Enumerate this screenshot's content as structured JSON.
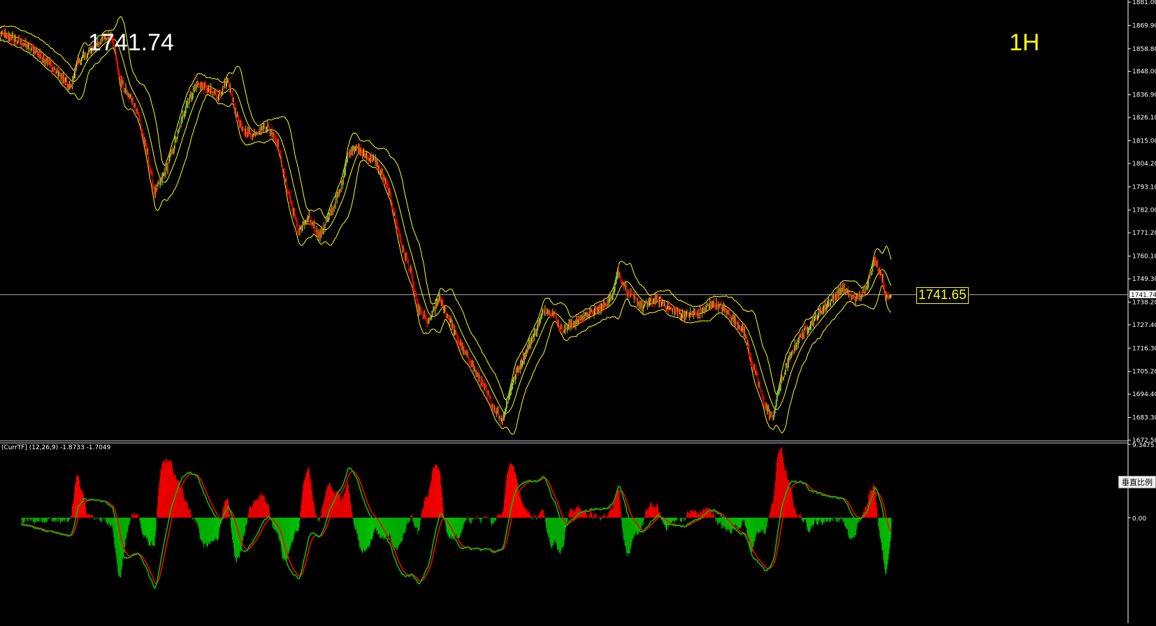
{
  "header": {
    "current_price": "1741.74",
    "timeframe": "1H"
  },
  "price_marker": "1741.65",
  "indicator": {
    "label": "(CurrTF] (12,26,9) -1.8733 -1.7049"
  },
  "scale_button": "垂直比例",
  "colors": {
    "background": "#000000",
    "bollinger": "#ffff00",
    "candle_up": "#9acd32",
    "candle_down": "#ff0000",
    "macd_line": "#00c000",
    "signal_line": "#ff0000",
    "hist_pos": "#ff0000",
    "hist_neg": "#00c000"
  },
  "chart_data": [
    {
      "type": "line",
      "name": "price",
      "ylim": [
        1672.5,
        1881.0
      ],
      "y_ticks": [
        "1881.00",
        "1869.90",
        "1858.80",
        "1848.00",
        "1836.90",
        "1826.10",
        "1815.00",
        "1804.20",
        "1793.10",
        "1782.00",
        "1771.20",
        "1760.10",
        "1749.30",
        "1738.20",
        "1727.40",
        "1716.30",
        "1705.20",
        "1694.40",
        "1683.30",
        "1672.50"
      ],
      "y_tick_values": [
        1881.0,
        1869.9,
        1858.8,
        1848.0,
        1836.9,
        1826.1,
        1815.0,
        1804.2,
        1793.1,
        1782.0,
        1771.2,
        1760.1,
        1749.3,
        1738.2,
        1727.4,
        1716.3,
        1705.2,
        1694.4,
        1683.3,
        1672.5
      ],
      "current_line": {
        "value": 1741.74,
        "label": "1741.74"
      },
      "n_bars": 1270,
      "close_keypoints": [
        [
          0,
          1866
        ],
        [
          30,
          1862
        ],
        [
          60,
          1855
        ],
        [
          80,
          1848
        ],
        [
          100,
          1840
        ],
        [
          110,
          1852
        ],
        [
          130,
          1858
        ],
        [
          140,
          1862
        ],
        [
          160,
          1865
        ],
        [
          170,
          1845
        ],
        [
          180,
          1838
        ],
        [
          195,
          1830
        ],
        [
          210,
          1808
        ],
        [
          220,
          1790
        ],
        [
          235,
          1800
        ],
        [
          250,
          1815
        ],
        [
          265,
          1832
        ],
        [
          280,
          1842
        ],
        [
          295,
          1840
        ],
        [
          310,
          1836
        ],
        [
          325,
          1843
        ],
        [
          335,
          1830
        ],
        [
          345,
          1820
        ],
        [
          360,
          1818
        ],
        [
          380,
          1822
        ],
        [
          395,
          1815
        ],
        [
          405,
          1798
        ],
        [
          415,
          1785
        ],
        [
          425,
          1772
        ],
        [
          440,
          1778
        ],
        [
          455,
          1770
        ],
        [
          470,
          1780
        ],
        [
          485,
          1792
        ],
        [
          495,
          1808
        ],
        [
          505,
          1812
        ],
        [
          520,
          1808
        ],
        [
          535,
          1805
        ],
        [
          545,
          1798
        ],
        [
          555,
          1790
        ],
        [
          565,
          1775
        ],
        [
          575,
          1762
        ],
        [
          585,
          1752
        ],
        [
          595,
          1735
        ],
        [
          610,
          1728
        ],
        [
          625,
          1740
        ],
        [
          640,
          1730
        ],
        [
          655,
          1718
        ],
        [
          670,
          1710
        ],
        [
          685,
          1700
        ],
        [
          700,
          1690
        ],
        [
          715,
          1682
        ],
        [
          730,
          1700
        ],
        [
          745,
          1712
        ],
        [
          760,
          1722
        ],
        [
          775,
          1735
        ],
        [
          790,
          1732
        ],
        [
          800,
          1725
        ],
        [
          815,
          1728
        ],
        [
          835,
          1732
        ],
        [
          855,
          1735
        ],
        [
          870,
          1740
        ],
        [
          880,
          1753
        ],
        [
          895,
          1742
        ],
        [
          915,
          1736
        ],
        [
          935,
          1740
        ],
        [
          955,
          1735
        ],
        [
          975,
          1732
        ],
        [
          995,
          1733
        ],
        [
          1015,
          1738
        ],
        [
          1030,
          1735
        ],
        [
          1045,
          1730
        ],
        [
          1060,
          1724
        ],
        [
          1070,
          1710
        ],
        [
          1080,
          1700
        ],
        [
          1090,
          1688
        ],
        [
          1100,
          1683
        ],
        [
          1110,
          1698
        ],
        [
          1125,
          1712
        ],
        [
          1140,
          1722
        ],
        [
          1160,
          1730
        ],
        [
          1180,
          1738
        ],
        [
          1200,
          1745
        ],
        [
          1215,
          1740
        ],
        [
          1230,
          1742
        ],
        [
          1245,
          1758
        ],
        [
          1255,
          1752
        ],
        [
          1262,
          1740
        ],
        [
          1269,
          1741.74
        ]
      ]
    },
    {
      "type": "bar",
      "name": "macd_histogram",
      "ylim": [
        -12.4,
        9.3475
      ],
      "y_ticks": [
        "9.3475",
        "0.00"
      ],
      "y_tick_values": [
        9.3475,
        0.0
      ],
      "indicator_params": "(12,26,9)"
    }
  ]
}
